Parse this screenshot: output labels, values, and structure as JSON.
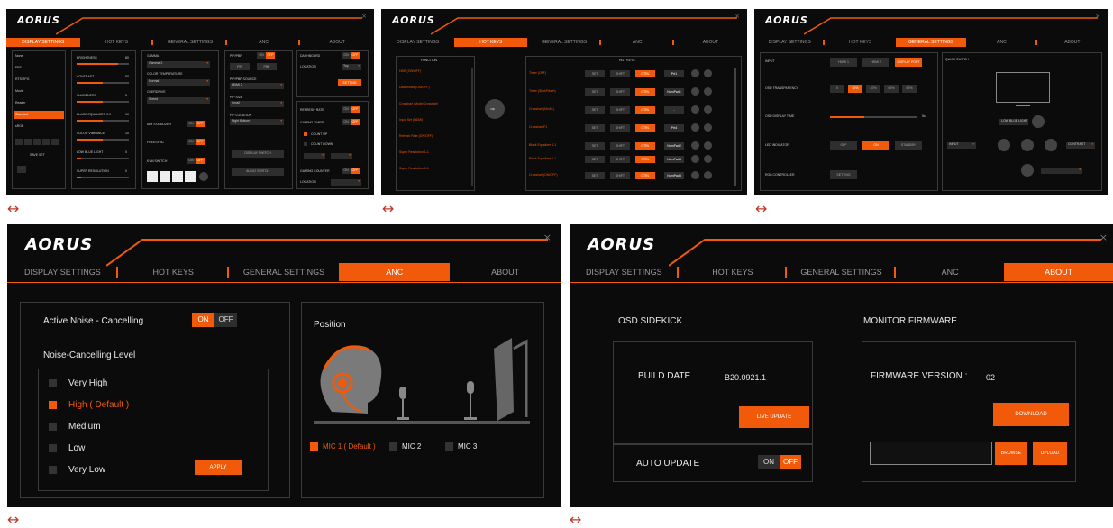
{
  "brand": "AORUS",
  "tabs": [
    "DISPLAY SETTINGS",
    "HOT KEYS",
    "GENERAL SETTINGS",
    "ANC",
    "ABOUT"
  ],
  "arrow_glyph": "↔",
  "display": {
    "sidebar": [
      "None",
      "FPS",
      "RTS/RPG",
      "Movie",
      "Reader",
      "Standard",
      "sRGB"
    ],
    "sidebar_footer": "SAVE SET",
    "sliders": [
      {
        "label": "BRIGHTNESS",
        "value": "80"
      },
      {
        "label": "CONTRAST",
        "value": "50"
      },
      {
        "label": "SHARPNESS",
        "value": "5"
      },
      {
        "label": "BLACK EQUALIZER 2.0",
        "value": "10"
      },
      {
        "label": "COLOR VIBRANCE",
        "value": "10"
      },
      {
        "label": "LOW BLUE LIGHT",
        "value": "0"
      },
      {
        "label": "SUPER RESOLUTION",
        "value": "0"
      }
    ],
    "gamma_label": "GAMMA",
    "gamma_value": "Gamma 2",
    "color_temp_label": "COLOR TEMPERATURE",
    "color_temp_value": "Normal",
    "overdrive_label": "OVERDRIVE",
    "overdrive_value": "Speed",
    "toggles": [
      "AIM STABILIZER",
      "FREESYNC",
      "KVM SWITCH"
    ],
    "pip_label": "PIP/PBP",
    "pip_buttons": [
      "PIP",
      "PBP"
    ],
    "pip_source_label": "PIP/PBP SOURCE",
    "pip_source_value": "HDMI 2",
    "pip_size_label": "PIP SIZE",
    "pip_size_value": "Small",
    "pip_location_label": "PIP LOCATION",
    "pip_location_value": "Right Bottom",
    "display_switch": "DISPLAY SWITCH",
    "audio_switch": "AUDIO SWITCH",
    "dashboard_label": "DASHBOARD",
    "location_label": "LOCATION",
    "location_value": "Top",
    "dash_setting": "SETTING",
    "refresh_label": "REFRESH RATE",
    "timer_label": "GAMING TIMER",
    "count_up": "COUNT UP",
    "count_down": "COUNT DOWN",
    "counter_label": "GAMING COUNTER",
    "counter_location": "LOCATION",
    "on": "ON",
    "off": "OFF"
  },
  "hotkeys": {
    "left_header": "FUNCTION",
    "left_items": [
      "HDR (ON/OFF)",
      "Dashboard (ON/OFF)",
      "Crosshair (Mode/Crosshair)",
      "Input Set (HDMI)",
      "Refresh Rate (ON/OFF)",
      "Super Resolution 1-1",
      "Super Resolution 1-1"
    ],
    "right_header": "HOT KEYS",
    "right_rows": [
      {
        "label": "Timer (OFF)",
        "key": "Prt1"
      },
      {
        "label": "Timer (Start/Reset)",
        "key": "NumPad1"
      },
      {
        "label": "Crosshair (Mod/1)",
        "key": "-"
      },
      {
        "label": "Crosshair F1",
        "key": "Prt4"
      },
      {
        "label": "Black Equalizer 0-1",
        "key": "NumPad2"
      },
      {
        "label": "Black Equalizer 1-1",
        "key": "NumPad3"
      },
      {
        "label": "Crosshair (ON/OFF)",
        "key": "NumPad3"
      }
    ],
    "btn_set": "SET",
    "btn_shift": "SHIFT",
    "btn_ctrl": "CTRL"
  },
  "general": {
    "input_label": "INPUT",
    "inputs": [
      "HDMI 1",
      "HDMI 2",
      "DISPLAY PORT"
    ],
    "transparency_label": "OSD TRANSPARENCY",
    "transparency_values": [
      "0",
      "20%",
      "40%",
      "60%",
      "80%"
    ],
    "display_time_label": "OSD DISPLAY TIME",
    "display_time_value": "5s",
    "led_label": "LED INDICATOR",
    "led_values": [
      "OFF",
      "ON",
      "STANDBY"
    ],
    "rgb_label": "RGB CONTROLLER",
    "rgb_button": "SETTING",
    "quick_switch": "QUICK SWITCH",
    "quick_top": "LOW BLUE LIGHT",
    "quick_left": "INPUT",
    "quick_right": "CONTRAST"
  },
  "anc": {
    "anc_label": "Active Noise - Cancelling",
    "on": "ON",
    "off": "OFF",
    "level_title": "Noise-Cancelling Level",
    "levels": [
      "Very High",
      "High ( Default )",
      "Medium",
      "Low",
      "Very Low"
    ],
    "apply": "APPLY",
    "position_title": "Position",
    "mics": [
      "MIC 1 ( Default )",
      "MIC 2",
      "MIC 3"
    ]
  },
  "about": {
    "osd_title": "OSD SIDEKICK",
    "build_label": "BUILD DATE",
    "build_value": "B20.0921.1",
    "live_update": "LIVE UPDATE",
    "auto_update": "AUTO UPDATE",
    "on": "ON",
    "off": "OFF",
    "fw_title": "MONITOR FIRMWARE",
    "fw_label": "FIRMWARE VERSION :",
    "fw_value": "02",
    "download": "DOWNLOAD",
    "browse": "BROWSE",
    "upload": "UPLOAD"
  },
  "colors": {
    "accent": "#f05a0a",
    "bg": "#0b0b0b",
    "arrow": "#c0392b"
  }
}
